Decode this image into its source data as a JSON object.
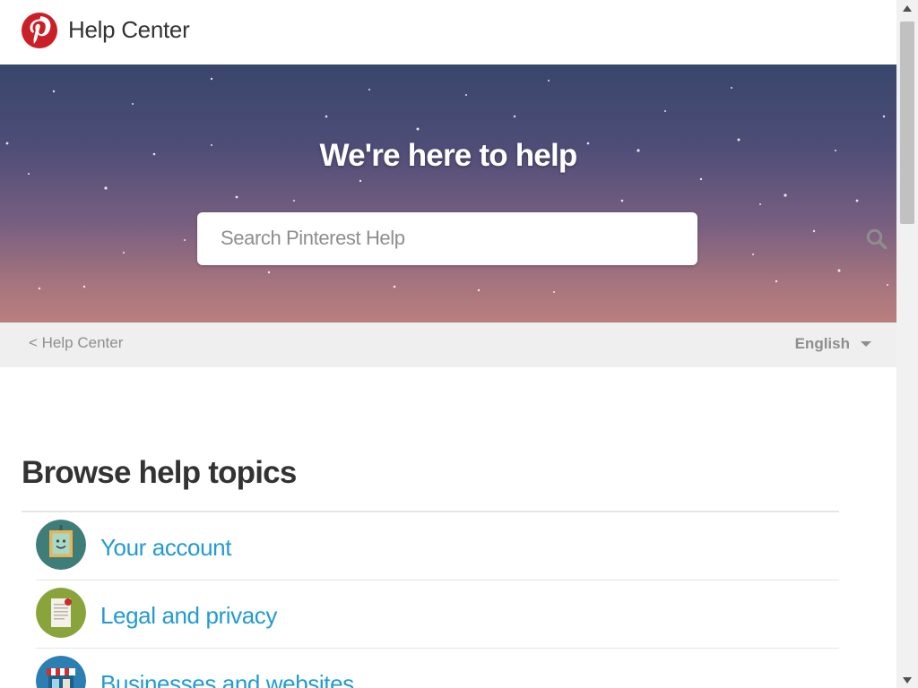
{
  "header": {
    "logo_icon": "pinterest-logo",
    "title": "Help Center"
  },
  "hero": {
    "title": "We're here to help",
    "search": {
      "placeholder": "Search Pinterest Help",
      "value": "",
      "icon": "search-icon"
    }
  },
  "subbar": {
    "breadcrumb": "< Help Center",
    "language": "English",
    "language_icon": "caret-down-icon"
  },
  "topics": {
    "title": "Browse help topics",
    "items": [
      {
        "label": "Your account",
        "icon": "picture-frame-icon"
      },
      {
        "label": "Legal and privacy",
        "icon": "document-icon"
      },
      {
        "label": "Businesses and websites",
        "icon": "storefront-icon"
      }
    ]
  },
  "colors": {
    "brand": "#cb1f27",
    "link": "#229bd1",
    "hero_top": "#39466b",
    "hero_bottom": "#b87f7f",
    "muted_text": "#8e8e8e"
  }
}
